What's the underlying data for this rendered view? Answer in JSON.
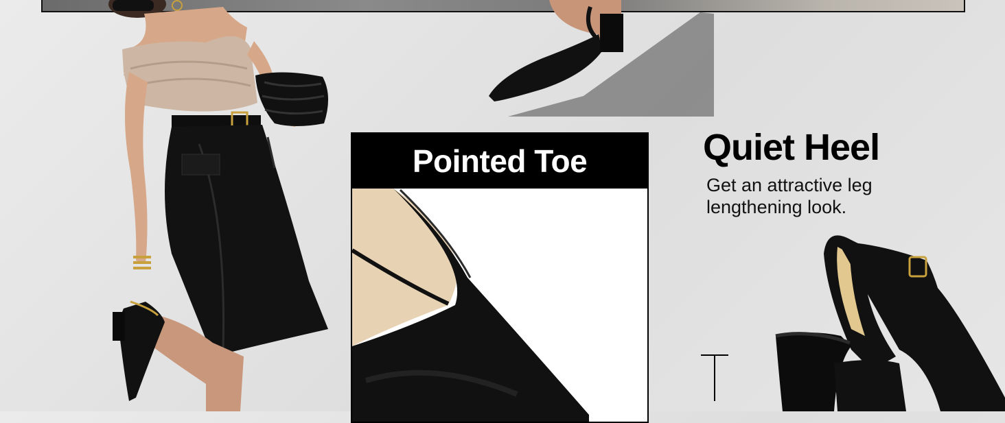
{
  "callout": {
    "title": "Pointed Toe"
  },
  "feature": {
    "heading": "Quiet Heel",
    "description": "Get an attractive leg lengthening look."
  },
  "icons": {
    "heel": "heel-height-icon"
  },
  "colors": {
    "card_header": "#000000",
    "background": "#e4e4e4",
    "shoe_leather": "#111111",
    "shoe_lining": "#e8d2b4",
    "top_fabric": "#cdb7a4"
  }
}
